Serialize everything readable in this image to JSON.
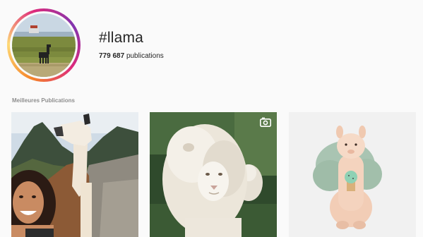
{
  "header": {
    "hashtag": "#llama",
    "post_count": "779 687",
    "post_count_label": "publications"
  },
  "top_posts": {
    "section_title": "Meilleures Publications",
    "posts": [
      {
        "icon": "llama-selfie-photo"
      },
      {
        "icon": "white-lion-photo",
        "badge_icon": "video-icon"
      },
      {
        "icon": "felt-llama-photo"
      }
    ]
  },
  "colors": {
    "background": "#fafafa",
    "text": "#262626",
    "secondary_text": "#8e8e8e",
    "ring_start": "#f58529",
    "ring_mid": "#dd2a7b",
    "ring_end": "#8134af"
  }
}
